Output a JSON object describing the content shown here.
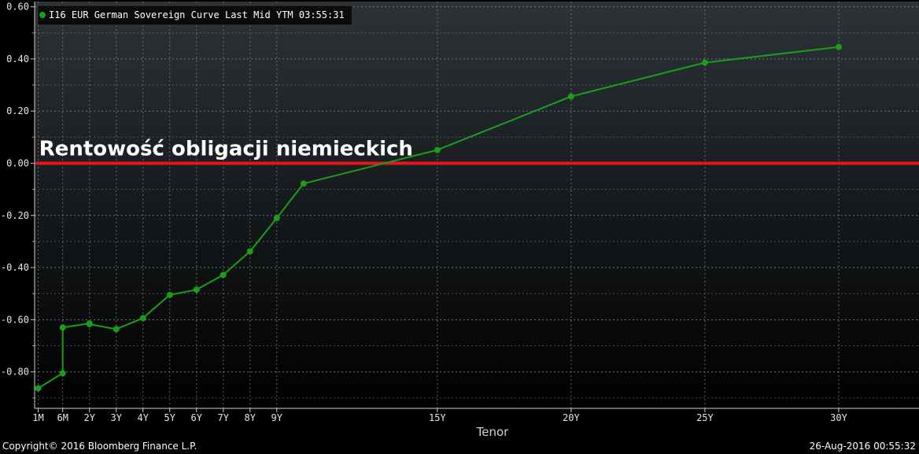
{
  "chart_data": {
    "type": "line",
    "legend": {
      "label": "I16 EUR German Sovereign Curve Last Mid YTM 03:55:31",
      "position": "top-left",
      "color": "#1a9e1a"
    },
    "annotation": {
      "text": "Rentowość obligacji niemieckich",
      "line_value": 0.0,
      "line_color": "#e8141a"
    },
    "xlabel": "Tenor",
    "ylabel": "",
    "ylim": [
      -0.94,
      0.62
    ],
    "yticks": [
      0.6,
      0.4,
      0.2,
      0.0,
      -0.2,
      -0.4,
      -0.6,
      -0.8
    ],
    "ytick_labels": [
      "0.60",
      "0.40",
      "0.20",
      "0.00",
      "-0.20",
      "-0.40",
      "-0.60",
      "-0.80"
    ],
    "xlim_years": [
      -0.05,
      33.0
    ],
    "xticks": [
      {
        "label": "1M",
        "x": 0.0833
      },
      {
        "label": "6M",
        "x": 1.0
      },
      {
        "label": "2Y",
        "x": 2.0
      },
      {
        "label": "3Y",
        "x": 3.0
      },
      {
        "label": "4Y",
        "x": 4.0
      },
      {
        "label": "5Y",
        "x": 5.0
      },
      {
        "label": "6Y",
        "x": 6.0
      },
      {
        "label": "7Y",
        "x": 7.0
      },
      {
        "label": "8Y",
        "x": 8.0
      },
      {
        "label": "9Y",
        "x": 9.0
      },
      {
        "label": "15Y",
        "x": 15.0
      },
      {
        "label": "20Y",
        "x": 20.0
      },
      {
        "label": "25Y",
        "x": 25.0
      },
      {
        "label": "30Y",
        "x": 30.0
      }
    ],
    "grid": true,
    "series": [
      {
        "name": "I16 EUR German Sovereign Curve Last Mid YTM 03:55:31",
        "color": "#1a9e1a",
        "points": [
          {
            "x": 0.0833,
            "y": -0.863
          },
          {
            "x": 1.0,
            "y": -0.805
          },
          {
            "x": 1.0,
            "y": -0.63
          },
          {
            "x": 2.0,
            "y": -0.614
          },
          {
            "x": 2.0,
            "y": -0.617
          },
          {
            "x": 3.0,
            "y": -0.636
          },
          {
            "x": 4.0,
            "y": -0.594
          },
          {
            "x": 5.0,
            "y": -0.505
          },
          {
            "x": 6.0,
            "y": -0.485
          },
          {
            "x": 7.0,
            "y": -0.428
          },
          {
            "x": 8.0,
            "y": -0.338
          },
          {
            "x": 9.0,
            "y": -0.21
          },
          {
            "x": 10.0,
            "y": -0.078
          },
          {
            "x": 15.0,
            "y": 0.051
          },
          {
            "x": 20.0,
            "y": 0.256
          },
          {
            "x": 25.0,
            "y": 0.386
          },
          {
            "x": 30.0,
            "y": 0.446
          }
        ]
      }
    ]
  },
  "footer": {
    "copyright": "Copyright© 2016 Bloomberg Finance L.P.",
    "timestamp": "26-Aug-2016 00:55:32"
  }
}
